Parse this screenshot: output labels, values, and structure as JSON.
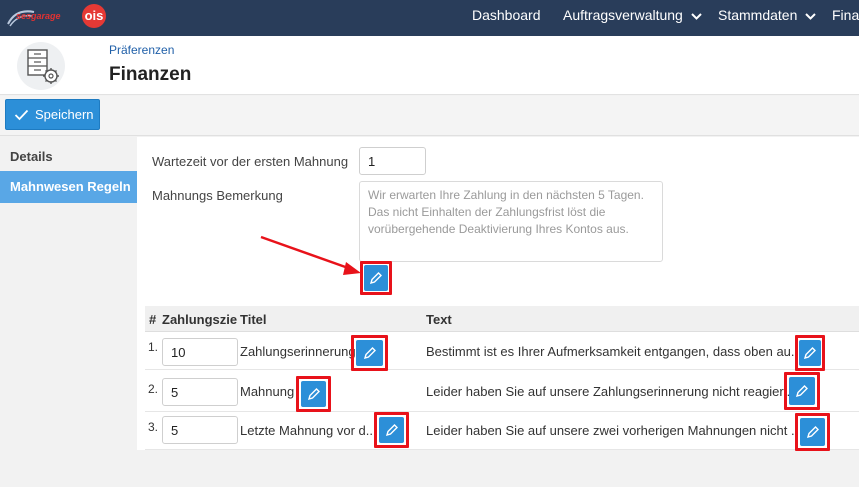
{
  "brand": {
    "logo_text": "sesgarage",
    "logo_badge": "ois"
  },
  "nav": {
    "items": [
      {
        "label": "Dashboard"
      },
      {
        "label": "Auftragsverwaltung"
      },
      {
        "label": "Stammdaten"
      },
      {
        "label": "Finan"
      }
    ]
  },
  "header": {
    "breadcrumb": "Präferenzen",
    "title": "Finanzen"
  },
  "toolbar": {
    "save_label": "Speichern"
  },
  "sidebar": {
    "items": [
      {
        "label": "Details",
        "active": false
      },
      {
        "label": "Mahnwesen Regeln",
        "active": true
      }
    ]
  },
  "form": {
    "wait_label": "Wartezeit vor der ersten Mahnung",
    "wait_value": "1",
    "remark_label": "Mahnungs Bemerkung",
    "remark_placeholder": "Wir erwarten Ihre Zahlung in den nächsten 5 Tagen. Das nicht Einhalten der Zahlungsfrist löst die vorübergehende Deaktivierung Ihres Kontos aus."
  },
  "table": {
    "headers": {
      "num": "#",
      "target": "Zahlungsziel",
      "title": "Titel",
      "text": "Text"
    },
    "rows": [
      {
        "num": "1.",
        "target": "10",
        "title": "Zahlungserinnerung",
        "text": "Bestimmt ist es Ihrer Aufmerksamkeit entgangen, dass oben au..."
      },
      {
        "num": "2.",
        "target": "5",
        "title": "Mahnung",
        "text": "Leider haben Sie auf unsere Zahlungserinnerung nicht reagier..."
      },
      {
        "num": "3.",
        "target": "5",
        "title": "Letzte Mahnung vor d...",
        "text": "Leider haben Sie auf unsere zwei vorherigen Mahnungen nicht ..."
      }
    ]
  },
  "colors": {
    "nav_bg": "#293d5a",
    "accent": "#2c8fd8",
    "highlight": "#e8121a",
    "sidebar_active": "#59a7e6"
  },
  "icons": [
    "sesgarage-logo",
    "chevron-down-icon",
    "settings-cabinet-icon",
    "check-icon",
    "pencil-icon",
    "red-arrow-annotation"
  ]
}
